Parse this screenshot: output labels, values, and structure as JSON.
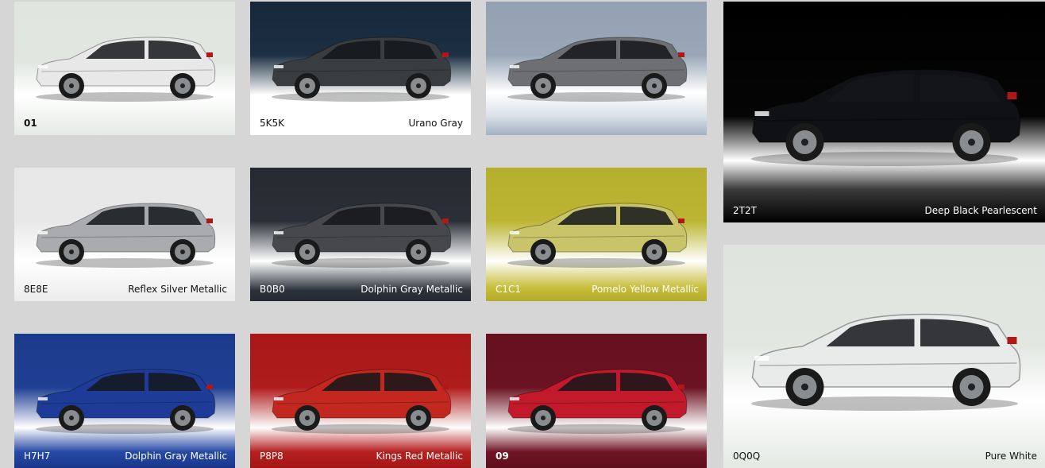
{
  "tiles": [
    {
      "code": "01",
      "name": "",
      "bg": "linear-gradient(180deg,#dfe5df 0%,#e1e6e1 45%,#ffffff 70%,#e6eae6 100%)",
      "car_color": "#e8e8e8",
      "text_color": "#111111",
      "code_bold": true
    },
    {
      "code": "5K5K",
      "name": "Urano Gray",
      "bg": "linear-gradient(180deg,#17283a 0%,#1c2f43 40%,#ffffff 70%,#ffffff 80%,#ffffff 100%)",
      "car_color": "#3a3d40",
      "text_color": "#111111",
      "code_bold": false
    },
    {
      "code": "",
      "name": "",
      "bg": "linear-gradient(180deg,#93a1b3 0%,#98a6b7 40%,#ffffff 68%,#dde3ea 85%,#a3b1c2 100%)",
      "car_color": "#6d6f72",
      "text_color": "#111111",
      "code_bold": false
    },
    {
      "code": "2T2T",
      "name": "Deep Black Pearlescent",
      "bg": "linear-gradient(180deg,#000000 0%,#050505 52%,#ffffff 72%,#3a3a3a 85%,#000000 100%)",
      "car_color": "#0f1114",
      "text_color": "#ffffff",
      "code_bold": false
    },
    {
      "code": "8E8E",
      "name": "Reflex Silver Metallic",
      "bg": "linear-gradient(180deg,#e6e7e6 0%,#e8e8e8 40%,#ffffff 70%,#ececec 100%)",
      "car_color": "#a9abae",
      "text_color": "#111111",
      "code_bold": false
    },
    {
      "code": "B0B0",
      "name": "Dolphin Gray Metallic",
      "bg": "linear-gradient(180deg,#252a31 0%,#2b3038 40%,#ffffff 70%,#2b313a 92%,#252a31 100%)",
      "car_color": "#46484c",
      "text_color": "#ffffff",
      "code_bold": false
    },
    {
      "code": "C1C1",
      "name": "Pomelo Yellow Metallic",
      "bg": "linear-gradient(180deg,#b6af2e 0%,#bcb534 40%,#ffffff 70%,#c7be3a 90%,#b3ab2a 100%)",
      "car_color": "#c9c36a",
      "text_color": "#ffffff",
      "code_bold": false
    },
    {
      "code": "0Q0Q",
      "name": "Pure White",
      "bg": "linear-gradient(180deg,#dfe4df 0%,#e2e7e2 45%,#ffffff 70%,#e4e9e4 100%)",
      "car_color": "#e9eaea",
      "text_color": "#111111",
      "code_bold": false
    },
    {
      "code": "H7H7",
      "name": "Dolphin Gray Metallic",
      "bg": "linear-gradient(180deg,#1c3a8a 0%,#1f3f94 40%,#ffffff 70%,#264aa4 88%,#1a358a 100%)",
      "car_color": "#1e3c97",
      "text_color": "#ffffff",
      "code_bold": false
    },
    {
      "code": "P8P8",
      "name": "Kings Red Metallic",
      "bg": "linear-gradient(180deg,#a81818 0%,#b01c1c 40%,#ffffff 70%,#b52020 88%,#a41616 100%)",
      "car_color": "#c2281f",
      "text_color": "#ffffff",
      "code_bold": false
    },
    {
      "code": "09",
      "name": "",
      "bg": "linear-gradient(180deg,#661020 0%,#6b1322 40%,#ffffff 70%,#701526 88%,#5f0d1c 100%)",
      "car_color": "#c21a2a",
      "text_color": "#ffffff",
      "code_bold": true
    }
  ]
}
